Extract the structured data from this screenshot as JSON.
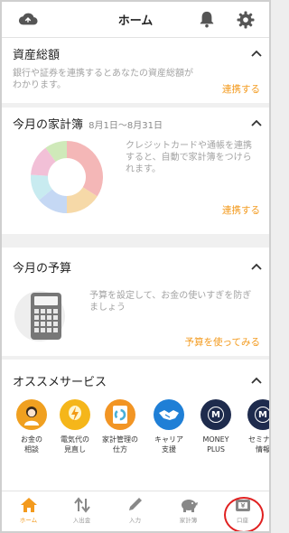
{
  "header": {
    "title": "ホーム"
  },
  "assets": {
    "title": "資産総額",
    "description": "銀行や証券を連携するとあなたの資産総額がわかります。",
    "link": "連携する"
  },
  "household": {
    "title": "今月の家計簿",
    "period": "8月1日〜8月31日",
    "description": "クレジットカードや通帳を連携すると、自動で家計簿をつけられます。",
    "link": "連携する",
    "donut_colors": [
      "#f4b7b7",
      "#f6d9a8",
      "#c5d8f4",
      "#c8ebf0",
      "#f2c0d7",
      "#cfe9b9"
    ]
  },
  "budget": {
    "title": "今月の予算",
    "description": "予算を設定して、お金の使いすぎを防ぎましょう",
    "link": "予算を使ってみる"
  },
  "services": {
    "title": "オススメサービス",
    "items": [
      {
        "label": "お金の\n相談",
        "color": "#f0a020",
        "icon": "person-icon"
      },
      {
        "label": "電気代の\n見直し",
        "color": "#f5b61a",
        "icon": "bolt-icon"
      },
      {
        "label": "家計管理の\n仕方",
        "color": "#f29524",
        "icon": "tablet-icon"
      },
      {
        "label": "キャリア\n支援",
        "color": "#1f7fd6",
        "icon": "handshake-icon"
      },
      {
        "label": "MONEY\nPLUS",
        "color": "#1e2b4d",
        "icon": "moneyplus-logo"
      },
      {
        "label": "セミナー\n情報",
        "color": "#1e2b4d",
        "icon": "seminar-logo"
      }
    ],
    "logo_letter": "M"
  },
  "nav": {
    "items": [
      {
        "label": "ホーム",
        "icon": "home-icon"
      },
      {
        "label": "入出金",
        "icon": "transfer-icon"
      },
      {
        "label": "入力",
        "icon": "pencil-icon"
      },
      {
        "label": "家計簿",
        "icon": "piggybank-icon"
      },
      {
        "label": "口座",
        "icon": "wallet-icon"
      }
    ]
  },
  "colors": {
    "accent": "#f39a1d",
    "highlight_ring": "#e02020"
  }
}
